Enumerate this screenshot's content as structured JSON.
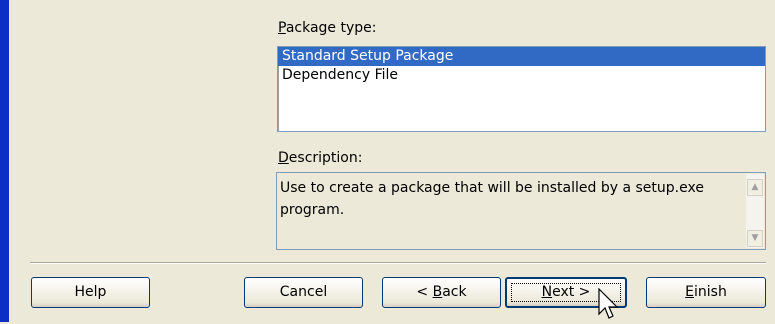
{
  "package_type": {
    "label": "Package type:",
    "label_hotkey": "P",
    "label_rest": "ackage type:",
    "items": [
      {
        "label": "Standard Setup Package",
        "selected": true
      },
      {
        "label": "Dependency File",
        "selected": false
      }
    ]
  },
  "description": {
    "label_hotkey": "D",
    "label_rest": "escription:",
    "text": "Use to create a package that will be installed by a setup.exe program."
  },
  "buttons": {
    "help": "Help",
    "cancel": "Cancel",
    "back_prefix": "< ",
    "back_hotkey": "B",
    "back_rest": "ack",
    "next_hotkey": "N",
    "next_rest": "ext >",
    "finish_hotkey": "E",
    "finish_rest": "inish"
  },
  "colors": {
    "accent_bar": "#0b2fc4",
    "selection": "#316ac5",
    "dialog_bg": "#ece9d8"
  }
}
